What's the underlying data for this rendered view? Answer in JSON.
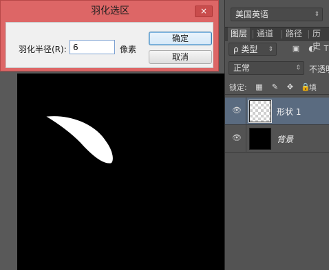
{
  "dialog": {
    "title": "羽化选区",
    "close_label": "×",
    "radius_label": "羽化半径(R):",
    "radius_value": "6",
    "unit": "像素",
    "ok_label": "确定",
    "cancel_label": "取消"
  },
  "panel": {
    "language": "美国英语",
    "tabs": [
      {
        "label": "图层"
      },
      {
        "label": "通道"
      },
      {
        "label": "路径"
      },
      {
        "label": "历史"
      }
    ],
    "filter_type": "ρ 类型",
    "blend_mode": "正常",
    "opacity_label": "不透明",
    "lock_label": "锁定:",
    "fill_label": "填",
    "layers": [
      {
        "name": "形状 1",
        "selected": true,
        "thumbnail": "transparent-checker",
        "visible": true
      },
      {
        "name": "背景",
        "selected": false,
        "thumbnail": "black",
        "visible": true
      }
    ]
  },
  "icons": {
    "dropdown": "chevron-down-icon",
    "eye": "eye-icon",
    "lock_transparent": "checker-lock-icon",
    "lock_paint": "brush-icon",
    "lock_move": "move-icon",
    "lock_all": "lock-icon"
  },
  "colors": {
    "dialog_title_bar": "#dd6666",
    "selected_layer": "#5a6b80",
    "canvas": "#000000",
    "shape_fill": "#ffffff"
  }
}
